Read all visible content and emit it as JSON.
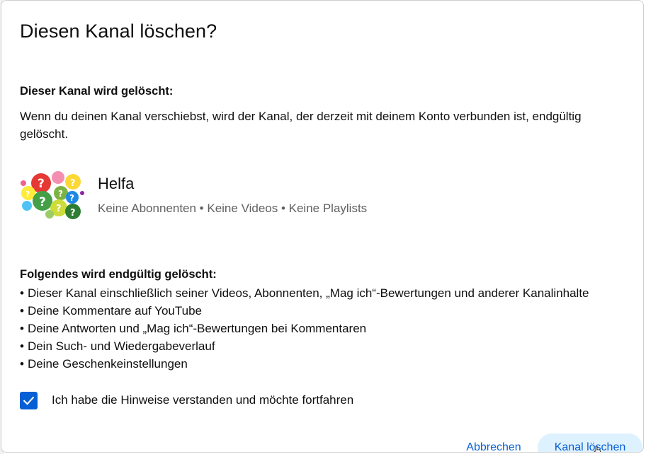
{
  "dialog": {
    "title": "Diesen Kanal löschen?",
    "section1_heading": "Dieser Kanal wird gelöscht:",
    "description": "Wenn du deinen Kanal verschiebst, wird der Kanal, der derzeit mit deinem Konto verbunden ist, endgültig gelöscht.",
    "channel": {
      "name": "Helfa",
      "stats": "Keine Abonnenten • Keine Videos • Keine Playlists",
      "avatar_icon": "question-bubbles-avatar"
    },
    "section2_heading": "Folgendes wird endgültig gelöscht:",
    "items": [
      "Dieser Kanal einschließlich seiner Videos, Abonnenten, „Mag ich“-Bewertungen und anderer Kanalinhalte",
      "Deine Kommentare auf YouTube",
      "Deine Antworten und „Mag ich“-Bewertungen bei Kommentaren",
      "Dein Such- und Wiedergabeverlauf",
      "Deine Geschenkeinstellungen"
    ],
    "confirm": {
      "label": "Ich habe die Hinweise verstanden und möchte fortfahren",
      "checked": true
    },
    "buttons": {
      "cancel": "Abbrechen",
      "delete": "Kanal löschen"
    }
  },
  "colors": {
    "accent": "#065fd4",
    "delete_button_bg": "#def1ff",
    "secondary_text": "#606060"
  }
}
